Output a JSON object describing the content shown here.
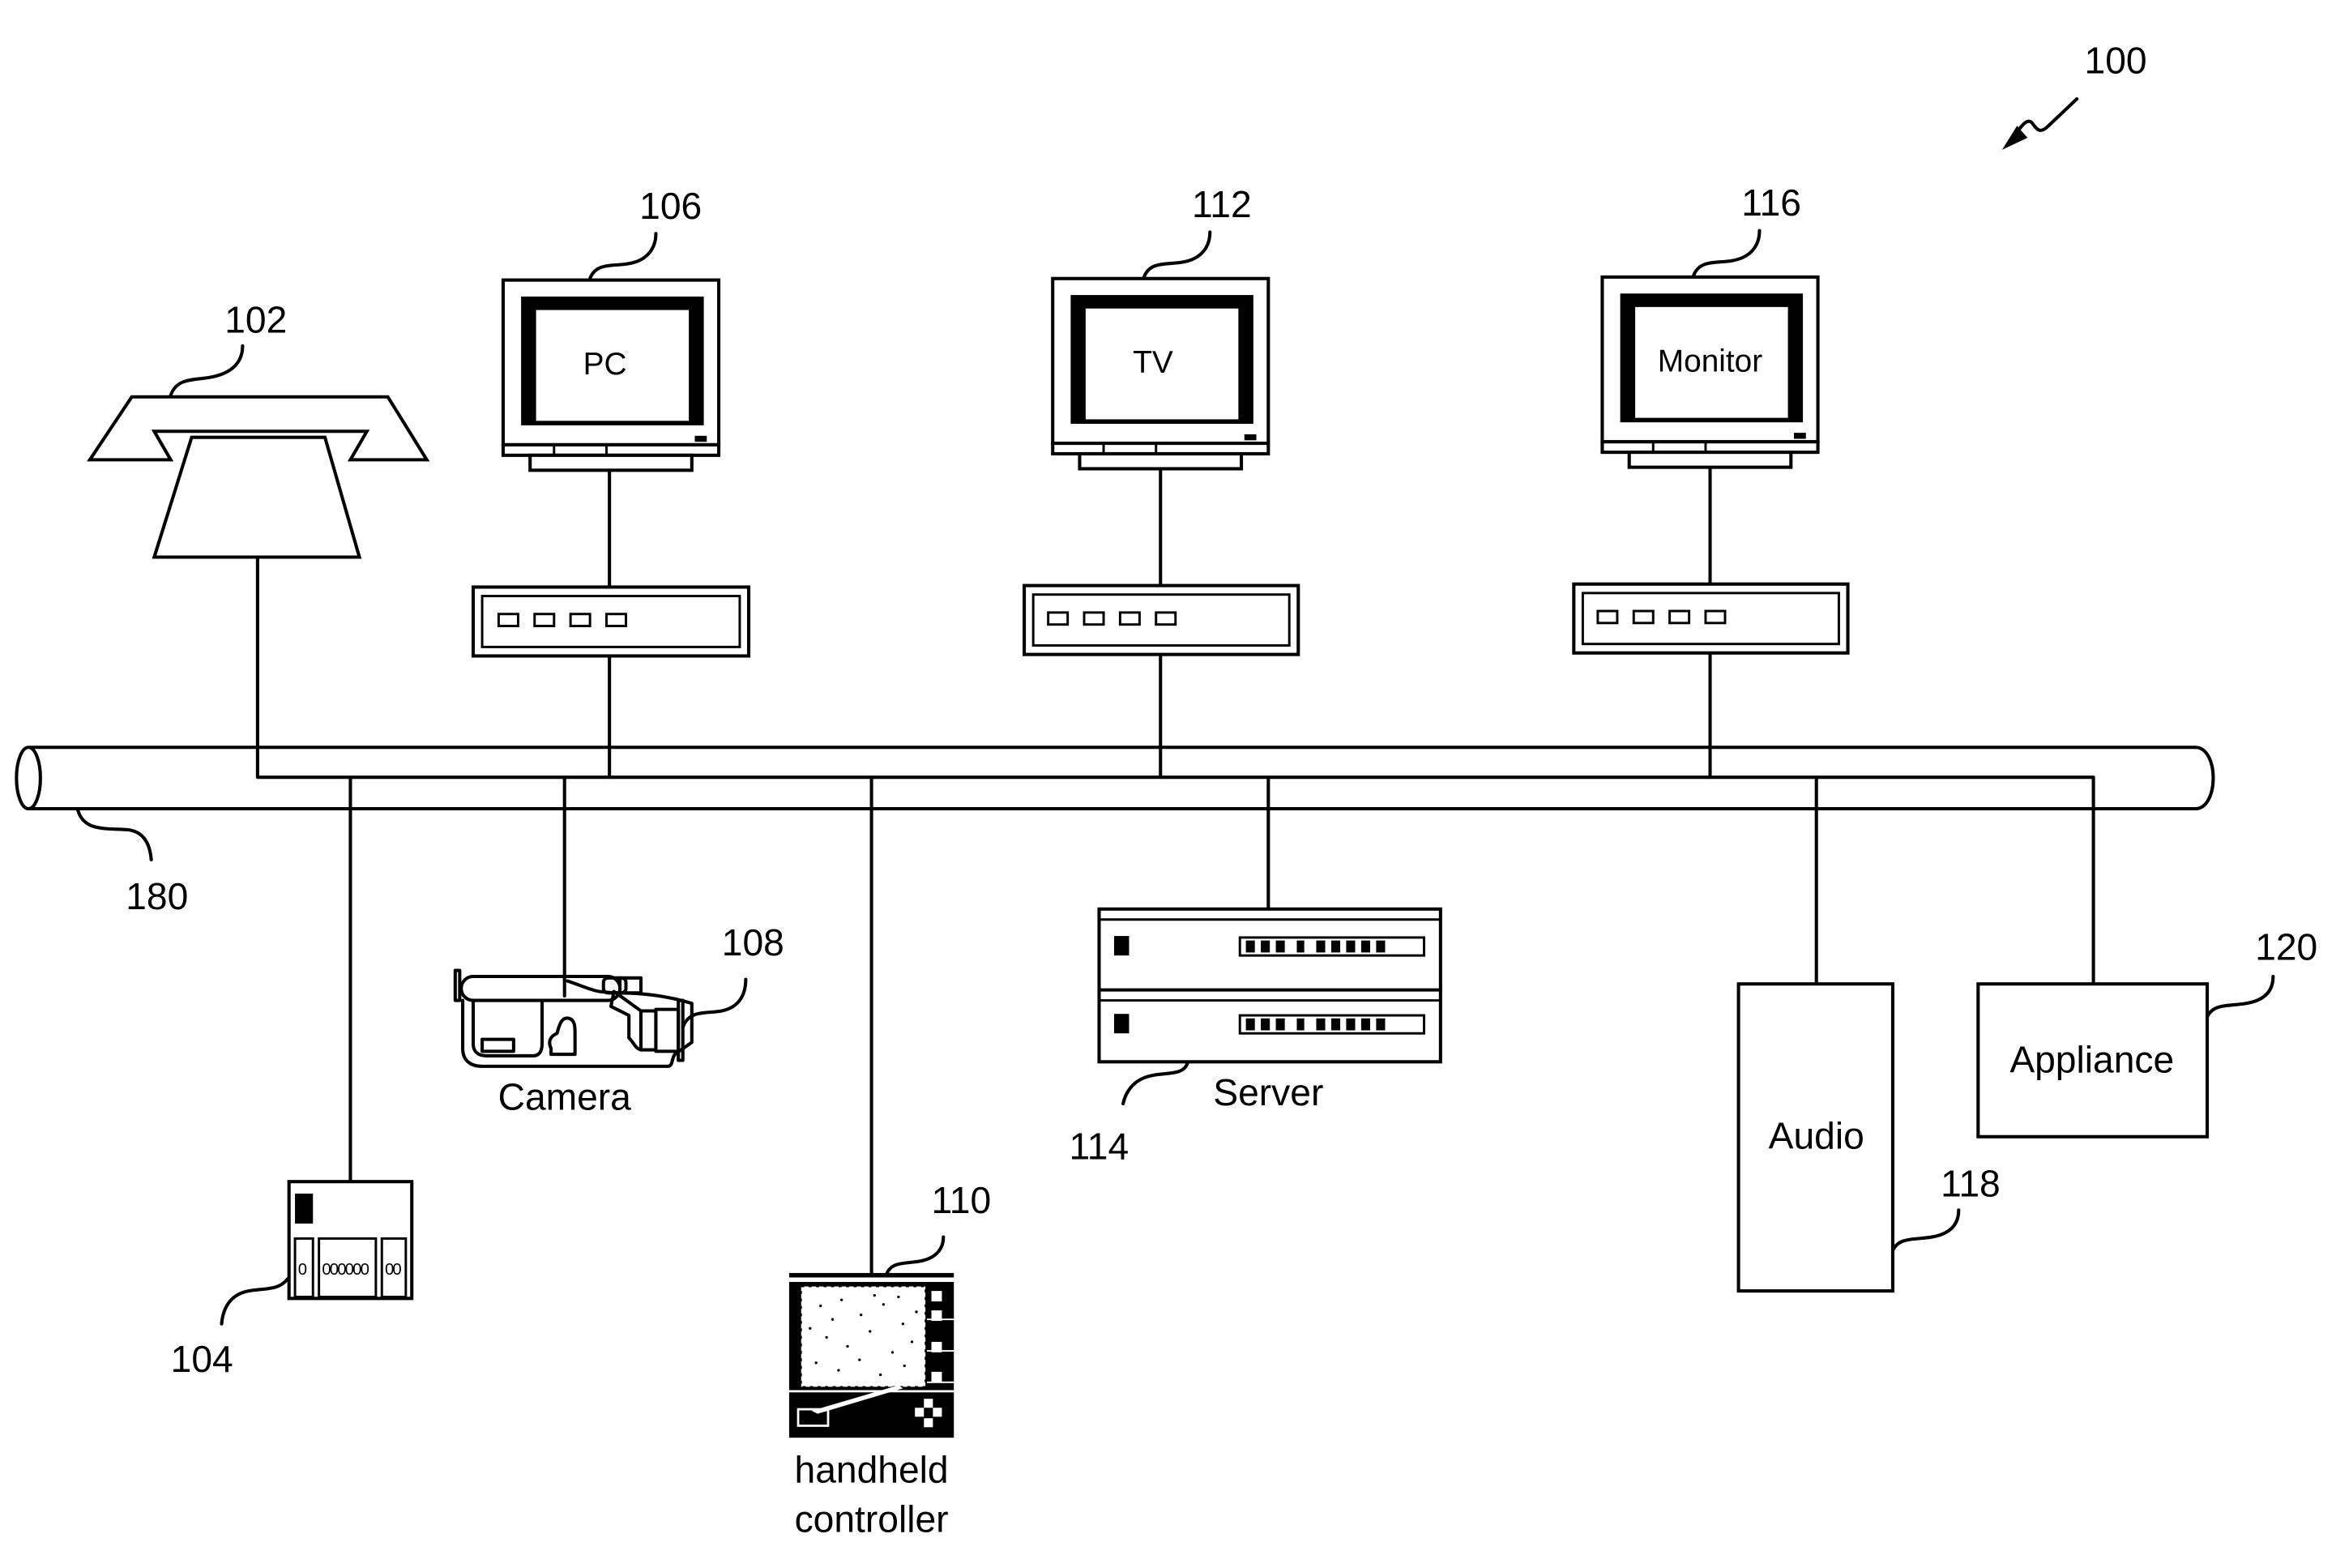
{
  "figure": {
    "system_ref": "100",
    "bus": {
      "ref": "180",
      "name": "network bus"
    },
    "devices": [
      {
        "key": "telephone",
        "ref": "102",
        "label": ""
      },
      {
        "key": "device104",
        "ref": "104",
        "label": ""
      },
      {
        "key": "pc",
        "ref": "106",
        "label": "PC"
      },
      {
        "key": "camera",
        "ref": "108",
        "label": "Camera"
      },
      {
        "key": "handheld",
        "ref": "110",
        "label_line1": "handheld",
        "label_line2": "controller"
      },
      {
        "key": "tv",
        "ref": "112",
        "label": "TV"
      },
      {
        "key": "server",
        "ref": "114",
        "label": "Server"
      },
      {
        "key": "monitor",
        "ref": "116",
        "label": "Monitor"
      },
      {
        "key": "audio",
        "ref": "118",
        "label": "Audio"
      },
      {
        "key": "appliance",
        "ref": "120",
        "label": "Appliance"
      }
    ],
    "colors": {
      "ink": "#000000",
      "paper": "#ffffff"
    }
  }
}
